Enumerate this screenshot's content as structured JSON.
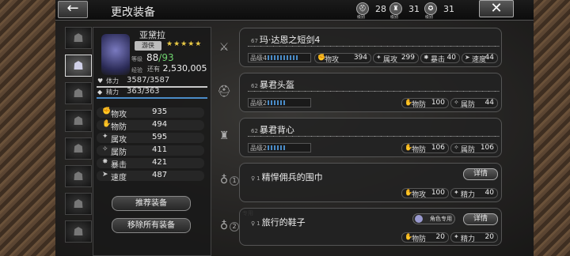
{
  "header": {
    "title": "更改装备",
    "back_icon": "←",
    "close_icon": "✕",
    "resources": [
      {
        "label": "级别",
        "value": "28"
      },
      {
        "label": "级别",
        "value": "31"
      },
      {
        "label": "级别",
        "value": "31"
      }
    ]
  },
  "characters": [
    "☗",
    "☗",
    "☗",
    "☗",
    "☗",
    "☗",
    "☗",
    "☗"
  ],
  "hero": {
    "name": "亚黛拉",
    "class": "游侠",
    "stars": "★★★★★",
    "level_label": "等级",
    "level": "88",
    "level_cap": "/93",
    "exp_label": "经验",
    "exp_prefix": "还有",
    "exp": "2,530,005",
    "hp_label": "体力",
    "hp": "3587/3587",
    "hp_fraction": 1.0,
    "sp_label": "精力",
    "sp": "363/363",
    "sp_fraction": 1.0
  },
  "stats": [
    {
      "icon": "✊",
      "label": "物攻",
      "value": "935"
    },
    {
      "icon": "✋",
      "label": "物防",
      "value": "494"
    },
    {
      "icon": "✦",
      "label": "属攻",
      "value": "595"
    },
    {
      "icon": "✧",
      "label": "属防",
      "value": "411"
    },
    {
      "icon": "✸",
      "label": "暴击",
      "value": "421"
    },
    {
      "icon": "➤",
      "label": "速度",
      "value": "487"
    }
  ],
  "buttons": {
    "recommend": "推荐装备",
    "remove_all": "移除所有装备",
    "detail": "详情"
  },
  "equipment": [
    {
      "slot_icon": "sword-icon",
      "level": "67",
      "name": "玛·达恩之短剑4",
      "refine": "品级4",
      "stats": [
        {
          "icon": "✊",
          "label": "物攻",
          "value": "394"
        },
        {
          "icon": "✦",
          "label": "属攻",
          "value": "299"
        },
        {
          "icon": "✸",
          "label": "暴击",
          "value": "40"
        },
        {
          "icon": "➤",
          "label": "速度",
          "value": "44"
        }
      ]
    },
    {
      "slot_icon": "helmet-icon",
      "level": "62",
      "name": "暴君头盔",
      "refine": "品级2",
      "stats": [
        {
          "icon": "✋",
          "label": "物防",
          "value": "100"
        },
        {
          "icon": "✧",
          "label": "属防",
          "value": "44"
        }
      ]
    },
    {
      "slot_icon": "armor-icon",
      "level": "62",
      "name": "暴君背心",
      "refine": "品级2",
      "stats": [
        {
          "icon": "✋",
          "label": "物防",
          "value": "106"
        },
        {
          "icon": "✧",
          "label": "属防",
          "value": "106"
        }
      ]
    },
    {
      "slot_icon": "accessory-icon",
      "slot_num": "1",
      "level": "1",
      "name": "精悍佣兵的围巾",
      "stats": [
        {
          "icon": "✋",
          "label": "物攻",
          "value": "100"
        },
        {
          "icon": "✦",
          "label": "精力",
          "value": "40"
        }
      ]
    },
    {
      "slot_icon": "accessory-icon",
      "slot_num": "2",
      "tag": "专用",
      "level": "1",
      "name": "旅行的鞋子",
      "exclusive": "角色专用",
      "stats": [
        {
          "icon": "✋",
          "label": "物防",
          "value": "20"
        },
        {
          "icon": "✦",
          "label": "精力",
          "value": "20"
        }
      ]
    }
  ]
}
